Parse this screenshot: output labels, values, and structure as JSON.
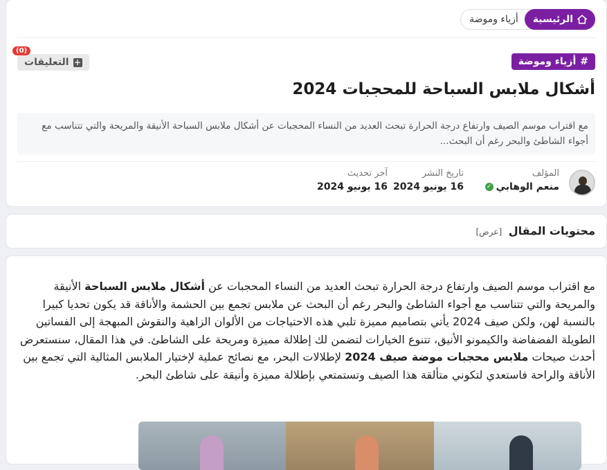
{
  "breadcrumb": {
    "home": "الرئيسية",
    "category": "أزياء وموضة"
  },
  "article_header": {
    "tag": "أزياء وموضة",
    "comments_label": "التعليقات",
    "comments_count": "(0)",
    "title": "أشكال ملابس السباحة للمحجبات 2024",
    "excerpt": "مع اقتراب موسم الصيف وارتفاع درجة الحرارة تبحث العديد من النساء المحجبات عن  أشكال ملابس السباحة  الأنيقة والمريحة والتي تتناسب مع أجواء الشاطئ والبحر  رغم أن البحث..."
  },
  "meta": {
    "author_label": "المؤلف",
    "author_name": "منعم الوهابي",
    "published_label": "تاريخ النشر",
    "published_date": "16 يونيو 2024",
    "updated_label": "آخر تحديث",
    "updated_date": "16 يونيو 2024"
  },
  "toc": {
    "title": "محتويات المقال",
    "toggle": "[عرض]"
  },
  "body": {
    "p1_a": "مع اقتراب موسم الصيف وارتفاع درجة الحرارة تبحث العديد من النساء المحجبات عن ",
    "p1_b": "أشكال ملابس السباحة",
    "p1_c": " الأنيقة والمريحة والتي تتناسب مع أجواء الشاطئ والبحر رغم أن البحث عن ملابس تجمع بين الحشمة والأناقة قد يكون تحديا كبيرا بالنسبة لهن، ولكن صيف 2024 يأتي بتصاميم مميزة تلبي هذه الاحتياجات من الألوان الزاهية والنقوش المبهجة إلى الفساتين الطويلة الفضفاضة والكيمونو الأنيق، تتنوع الخيارات لتضمن لك إطلالة مميزة ومريحة على الشاطئ. في هذا المقال، سنستعرض أحدث صيحات ",
    "p1_d": "ملابس محجبات موضة صيف 2024",
    "p1_e": " لإطلالات البحر، مع نصائح عملية لإختيار الملابس المثالية التي تجمع بين الأناقة والراحة فاستعدي لتكوني متألقة هذا الصيف وتستمتعي بإطلالة مميزة وأنيقة على شاطئ البحر."
  },
  "icons": {
    "home": "home-icon",
    "hash": "hash-icon",
    "comment": "comment-plus-icon",
    "verified": "verified-check-icon"
  },
  "colors": {
    "accent": "#7b1fa2",
    "badge": "#e53935",
    "verified": "#43a047"
  }
}
